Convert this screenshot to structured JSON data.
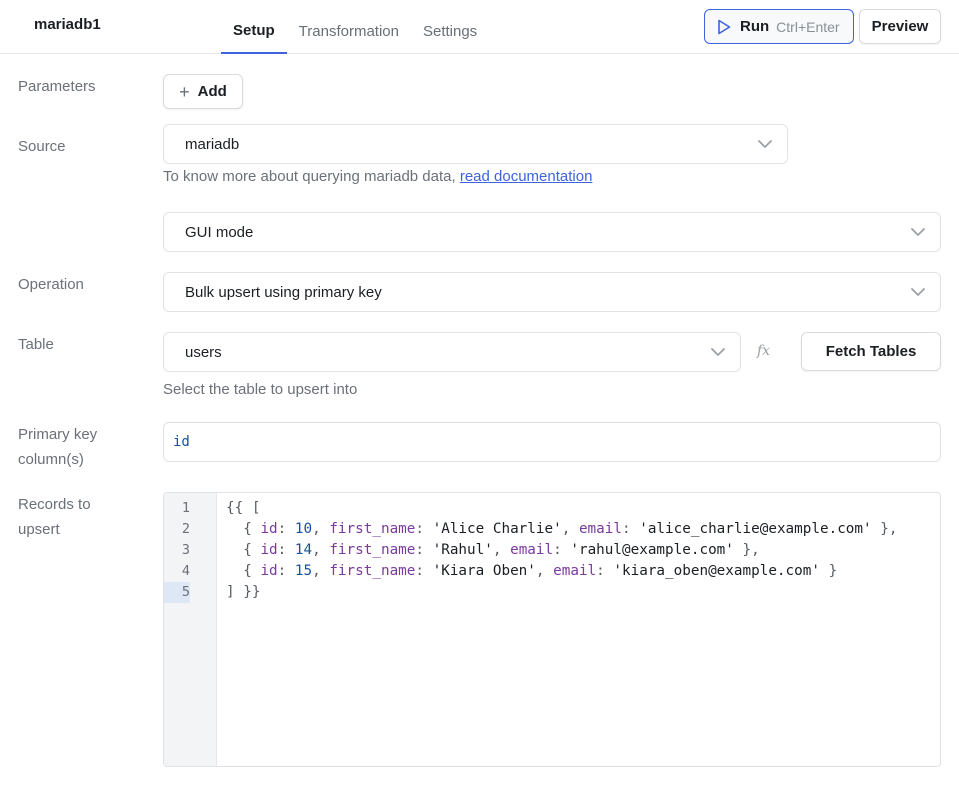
{
  "header": {
    "query_name": "mariadb1",
    "tabs": [
      {
        "label": "Setup",
        "active": true
      },
      {
        "label": "Transformation",
        "active": false
      },
      {
        "label": "Settings",
        "active": false
      }
    ],
    "run_label": "Run",
    "run_shortcut": "Ctrl+Enter",
    "preview_label": "Preview"
  },
  "form": {
    "parameters_label": "Parameters",
    "add_label": "Add",
    "source_label": "Source",
    "source_value": "mariadb",
    "source_help_text": "To know more about querying mariadb data,",
    "source_help_link": "read documentation",
    "mode_value": "GUI mode",
    "operation_label": "Operation",
    "operation_value": "Bulk upsert using primary key",
    "table_label": "Table",
    "table_value": "users",
    "fx_label": "fx",
    "fetch_tables_label": "Fetch Tables",
    "table_help": "Select the table to upsert into",
    "pk_label_line1": "Primary key",
    "pk_label_line2": "column(s)",
    "pk_value": "id",
    "records_label_line1": "Records to",
    "records_label_line2": "upsert"
  },
  "editor": {
    "line_numbers": [
      "1",
      "2",
      "3",
      "4",
      "5"
    ],
    "active_line": 5,
    "lines": [
      "{{ [",
      "  { id: 10, first_name: 'Alice Charlie', email: 'alice_charlie@example.com' },",
      "  { id: 14, first_name: 'Rahul', email: 'rahul@example.com' },",
      "  { id: 15, first_name: 'Kiara Oben', email: 'kiara_oben@example.com' }",
      "] }}"
    ]
  },
  "colors": {
    "accent": "#3e63dd",
    "link": "#3e63dd",
    "border": "#dfe3e6",
    "label": "#6b7079"
  },
  "icons": {
    "run": "play-icon",
    "add": "plus-icon",
    "dropdown": "chevron-down-icon"
  }
}
